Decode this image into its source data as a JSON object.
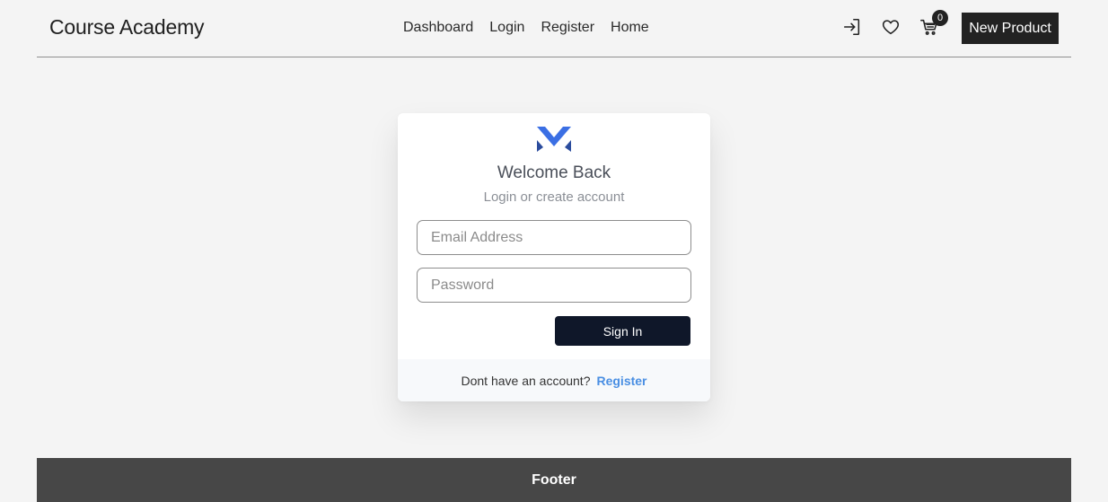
{
  "header": {
    "brand": "Course Academy",
    "nav": [
      "Dashboard",
      "Login",
      "Register",
      "Home"
    ],
    "icons": [
      "login-icon",
      "heart-icon",
      "cart-icon"
    ],
    "cart_count": "0",
    "new_product_label": "New Product"
  },
  "login": {
    "logo": "m-logo-icon",
    "title": "Welcome Back",
    "subtitle": "Login or create account",
    "email_placeholder": "Email Address",
    "password_placeholder": "Password",
    "signin_label": "Sign In",
    "footer_text": "Dont have an account?",
    "register_link": "Register"
  },
  "footer": {
    "label": "Footer"
  },
  "colors": {
    "accent": "#3b6fe4",
    "signin_bg": "#0f1729",
    "link": "#4a8fe3",
    "footer_bg": "#474747"
  }
}
